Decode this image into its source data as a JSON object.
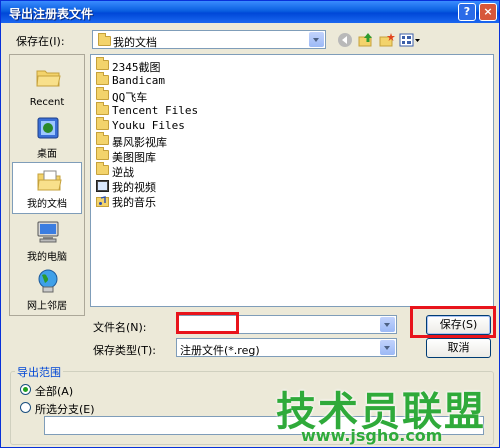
{
  "window": {
    "title": "导出注册表文件",
    "help_glyph": "?",
    "close_glyph": "×"
  },
  "save_in": {
    "label": "保存在(I):",
    "location": "我的文档"
  },
  "places": [
    {
      "label": "Recent",
      "icon": "recent-folder-icon"
    },
    {
      "label": "桌面",
      "icon": "desktop-icon"
    },
    {
      "label": "我的文档",
      "icon": "my-documents-icon",
      "selected": true
    },
    {
      "label": "我的电脑",
      "icon": "my-computer-icon"
    },
    {
      "label": "网上邻居",
      "icon": "network-icon"
    }
  ],
  "files": [
    {
      "name": "2345截图",
      "icon": "folder-icon"
    },
    {
      "name": "Bandicam",
      "icon": "folder-icon"
    },
    {
      "name": "QQ飞车",
      "icon": "folder-icon"
    },
    {
      "name": "Tencent Files",
      "icon": "folder-icon"
    },
    {
      "name": "Youku Files",
      "icon": "folder-icon"
    },
    {
      "name": "暴风影视库",
      "icon": "folder-icon"
    },
    {
      "name": "美图图库",
      "icon": "folder-icon"
    },
    {
      "name": "逆战",
      "icon": "folder-icon"
    },
    {
      "name": "我的视频",
      "icon": "video-folder-icon"
    },
    {
      "name": "我的音乐",
      "icon": "music-folder-icon"
    }
  ],
  "filename": {
    "label": "文件名(N):",
    "value": ""
  },
  "filetype": {
    "label": "保存类型(T):",
    "value": "注册文件(*.reg)"
  },
  "buttons": {
    "save": "保存(S)",
    "cancel": "取消"
  },
  "export_range": {
    "title": "导出范围",
    "all_label": "全部(A)",
    "branch_label": "所选分支(E)",
    "selected": "all",
    "branch_value": ""
  },
  "watermark": {
    "text": "技术员联盟",
    "url": "www.jsgho.com"
  },
  "colors": {
    "titlebar": "#0a5fe0",
    "highlight_box": "#e8141b",
    "watermark": "#2faa3a"
  }
}
